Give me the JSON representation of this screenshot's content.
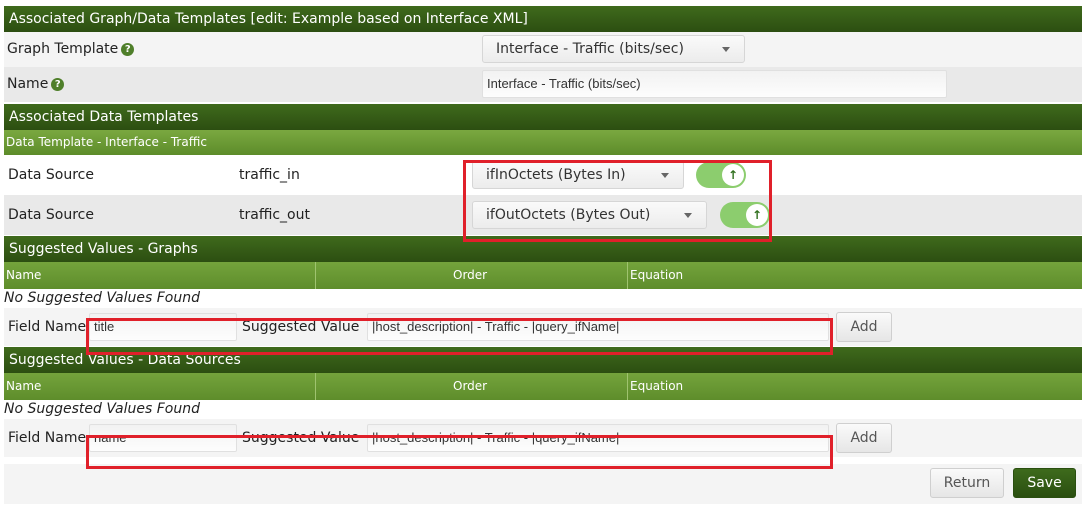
{
  "sections": {
    "associated_graph_templates": "Associated Graph/Data Templates [edit: Example based on Interface XML]",
    "associated_data_templates": "Associated Data Templates",
    "data_template_sub": "Data Template - Interface - Traffic",
    "suggested_graphs": "Suggested Values - Graphs",
    "suggested_data_sources": "Suggested Values - Data Sources"
  },
  "graph_template": {
    "label": "Graph Template",
    "value": "Interface - Traffic (bits/sec)"
  },
  "name_field": {
    "label": "Name",
    "value": "Interface - Traffic (bits/sec)"
  },
  "data_sources": [
    {
      "label": "Data Source",
      "name": "traffic_in",
      "select": "ifInOctets (Bytes In)"
    },
    {
      "label": "Data Source",
      "name": "traffic_out",
      "select": "ifOutOctets (Bytes Out)"
    }
  ],
  "columns": {
    "name": "Name",
    "order": "Order",
    "equation": "Equation"
  },
  "no_values": "No Suggested Values Found",
  "graph_suggest": {
    "field_label": "Field Name",
    "field_value": "title",
    "suggest_label": "Suggested Value",
    "suggest_value": "|host_description| - Traffic - |query_ifName|",
    "add": "Add"
  },
  "ds_suggest": {
    "field_label": "Field Name",
    "field_value": "name",
    "suggest_label": "Suggested Value",
    "suggest_value": "|host_description| - Traffic - |query_ifName|",
    "add": "Add"
  },
  "actions": {
    "return": "Return",
    "save": "Save"
  },
  "colors": {
    "header": "#2c4e11",
    "subheader": "#6b9a35",
    "highlight": "#e0202a",
    "toggle": "#8ccd6e"
  }
}
